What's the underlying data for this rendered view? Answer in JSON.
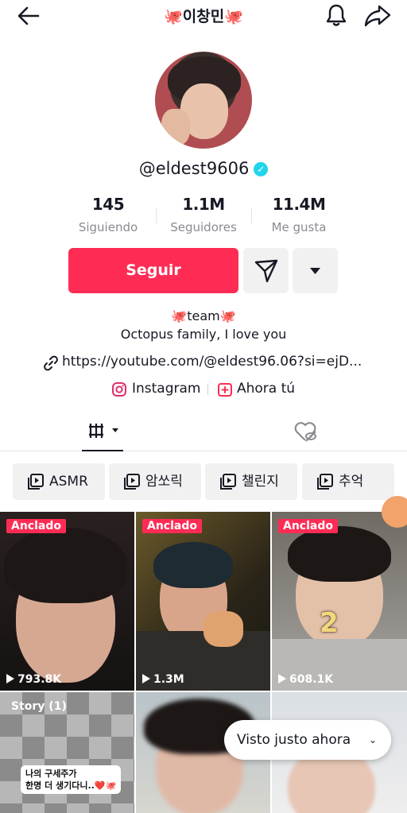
{
  "header": {
    "title": "🐙이창민🐙"
  },
  "profile": {
    "username": "@eldest9606",
    "verified_badge": "✓"
  },
  "stats": [
    {
      "value": "145",
      "label": "Siguiendo"
    },
    {
      "value": "1.1M",
      "label": "Seguidores"
    },
    {
      "value": "11.4M",
      "label": "Me gusta"
    }
  ],
  "actions": {
    "follow": "Seguir"
  },
  "bio": {
    "line1": "🐙team🐙",
    "line2": "Octopus family, I love you",
    "link": "https://youtube.com/@eldest96.06?si=ejD...",
    "instagram": "Instagram",
    "ahora_tu": "Ahora tú"
  },
  "playlists": [
    "ASMR",
    "암쏘릭",
    "챌린지",
    "추억"
  ],
  "videos": [
    {
      "pinned": "Anclado",
      "views": "793.8K"
    },
    {
      "pinned": "Anclado",
      "views": "1.3M"
    },
    {
      "pinned": "Anclado",
      "views": "608.1K",
      "overlay": "2"
    },
    {
      "story": "Story (1)",
      "note_line1": "나의 구세주가",
      "note_line2": "한명 더 생기다니..❤️🐙"
    },
    {},
    {}
  ],
  "toast": {
    "label": "Visto justo ahora",
    "chevron": "⌄"
  },
  "colors": {
    "accent": "#fe2c55",
    "verified": "#20d5ec",
    "muted_text": "#8a8b91",
    "button_bg": "#f1f1f2"
  },
  "icons": [
    "back-arrow-icon",
    "bell-icon",
    "share-icon",
    "send-icon",
    "chevron-down-icon",
    "link-icon",
    "instagram-icon",
    "add-box-icon",
    "grid-icon",
    "liked-hidden-icon",
    "playlist-icon",
    "play-icon"
  ]
}
